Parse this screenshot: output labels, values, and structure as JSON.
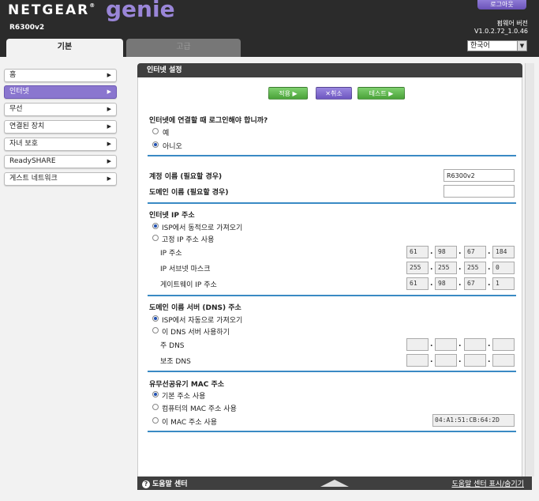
{
  "header": {
    "brand": "NETGEAR",
    "brand_mark": "®",
    "product": "genie",
    "product_mark": "™",
    "model": "R6300v2",
    "logout_label": "로그아웃",
    "firmware_label": "펌웨어 버전",
    "firmware_version": "V1.0.2.72_1.0.46",
    "language": "한국어",
    "tabs": {
      "basic": "기본",
      "advanced": "고급"
    }
  },
  "sidebar": {
    "items": [
      {
        "label": "홈"
      },
      {
        "label": "인터넷",
        "active": true
      },
      {
        "label": "무선"
      },
      {
        "label": "연결된 장치"
      },
      {
        "label": "자녀 보호"
      },
      {
        "label": "ReadySHARE"
      },
      {
        "label": "게스트 네트워크"
      }
    ],
    "arrow": "▶"
  },
  "panel": {
    "title": "인터넷 설정",
    "buttons": {
      "apply": "적용 ▶",
      "cancel": "✕취소",
      "test": "테스트 ▶"
    }
  },
  "login_required": {
    "question": "인터넷에 연결할 때 로그인해야 합니까?",
    "options": [
      "예",
      "아니오"
    ],
    "selected": "아니오"
  },
  "account": {
    "account_label": "계정 이름 (필요할 경우)",
    "account_value": "R6300v2",
    "domain_label": "도메인 이름 (필요할 경우)",
    "domain_value": ""
  },
  "internet_ip": {
    "title": "인터넷 IP 주소",
    "options": [
      "ISP에서 동적으로 가져오기",
      "고정 IP 주소 사용"
    ],
    "selected": "ISP에서 동적으로 가져오기",
    "ip_label": "IP 주소",
    "ip": [
      "61",
      "98",
      "67",
      "184"
    ],
    "mask_label": "IP 서브넷 마스크",
    "mask": [
      "255",
      "255",
      "255",
      "0"
    ],
    "gateway_label": "게이트웨이 IP 주소",
    "gateway": [
      "61",
      "98",
      "67",
      "1"
    ]
  },
  "dns": {
    "title": "도메인 이름 서버 (DNS) 주소",
    "options": [
      "ISP에서 자동으로 가져오기",
      "이 DNS 서버 사용하기"
    ],
    "selected": "ISP에서 자동으로 가져오기",
    "primary_label": "주 DNS",
    "secondary_label": "보조 DNS",
    "primary": [
      "",
      "",
      "",
      ""
    ],
    "secondary": [
      "",
      "",
      "",
      ""
    ]
  },
  "mac": {
    "title": "유무선공유기 MAC 주소",
    "options": [
      "기본 주소 사용",
      "컴퓨터의 MAC 주소 사용",
      "이 MAC 주소 사용"
    ],
    "selected": "기본 주소 사용",
    "value": "04:A1:51:CB:64:2D"
  },
  "footer": {
    "help_icon": "?",
    "help_center": "도움말 센터",
    "toggle": "도움말 센터 표시/숨기기"
  },
  "colors": {
    "accent_purple": "#8a76cf",
    "button_green": "#4aa239",
    "divider_blue": "#3a8ac4",
    "header_dark": "#2b2b2b"
  }
}
